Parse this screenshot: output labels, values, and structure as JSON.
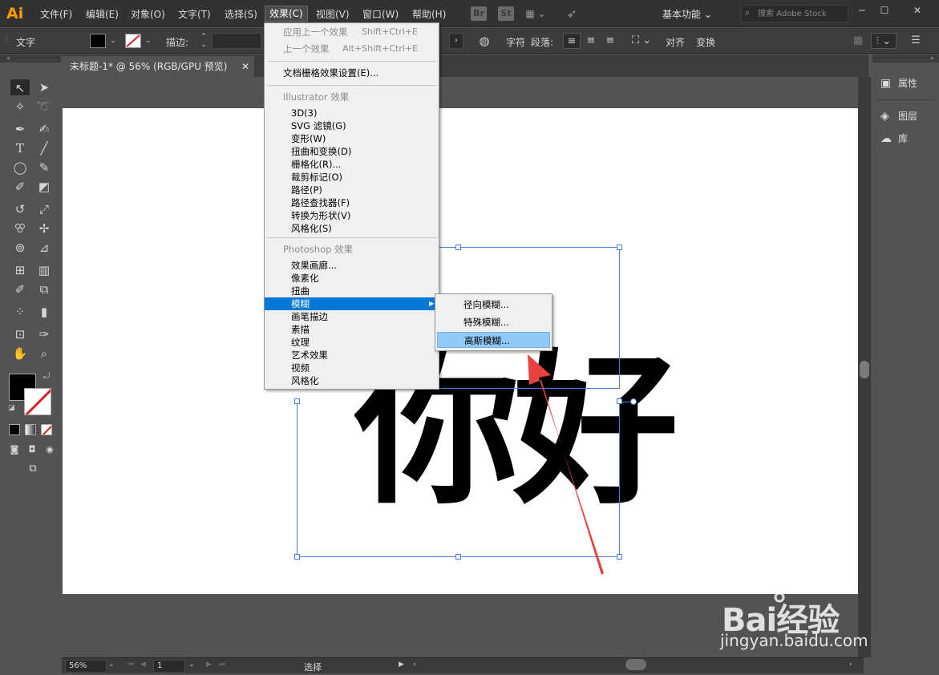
{
  "app": {
    "logo": "Ai"
  },
  "menubar": {
    "items": [
      "文件(F)",
      "编辑(E)",
      "对象(O)",
      "文字(T)",
      "选择(S)",
      "效果(C)",
      "视图(V)",
      "窗口(W)",
      "帮助(H)"
    ],
    "app_switchers": [
      "Br",
      "St"
    ],
    "workspace": "基本功能",
    "search_placeholder": "搜索 Adobe Stock"
  },
  "control_bar": {
    "selection_label": "文字",
    "stroke_label": "描边:",
    "char_label": "字符",
    "para_label": "段落:",
    "align_label": "对齐",
    "transform_label": "变换"
  },
  "document": {
    "tab_title": "未标题-1* @ 56% (RGB/GPU 预览)",
    "close": "✕",
    "glyph_text": "你好"
  },
  "effect_menu": {
    "top_items": [
      {
        "label": "应用上一个效果",
        "shortcut": "Shift+Ctrl+E",
        "enabled": false
      },
      {
        "label": "上一个效果",
        "shortcut": "Alt+Shift+Ctrl+E",
        "enabled": false
      }
    ],
    "raster_settings": "文档栅格效果设置(E)...",
    "illustrator_header": "Illustrator 效果",
    "illustrator_items": [
      "3D(3)",
      "SVG 滤镜(G)",
      "变形(W)",
      "扭曲和变换(D)",
      "栅格化(R)...",
      "裁剪标记(O)",
      "路径(P)",
      "路径查找器(F)",
      "转换为形状(V)",
      "风格化(S)"
    ],
    "photoshop_header": "Photoshop 效果",
    "photoshop_items": [
      "效果画廊...",
      "像素化",
      "扭曲",
      "模糊",
      "画笔描边",
      "素描",
      "纹理",
      "艺术效果",
      "视频",
      "风格化"
    ],
    "highlighted": "模糊"
  },
  "blur_submenu": {
    "items": [
      "径向模糊...",
      "特殊模糊...",
      "高斯模糊..."
    ],
    "hovered": "高斯模糊..."
  },
  "right_panel": {
    "items": [
      {
        "label": "属性",
        "icon": "properties-icon"
      },
      {
        "label": "图层",
        "icon": "layers-icon"
      },
      {
        "label": "库",
        "icon": "libraries-icon"
      }
    ]
  },
  "status_bar": {
    "zoom": "56%",
    "artboard": "1",
    "tool": "选择"
  },
  "watermark": {
    "logo": "Bai经验",
    "url": "jingyan.baidu.com"
  },
  "colors": {
    "menu_highlight": "#0078d7",
    "submenu_hover": "#91c9f7",
    "selection": "#4a7fd6",
    "arrow": "#e8423f",
    "logo": "#ff9a00"
  }
}
